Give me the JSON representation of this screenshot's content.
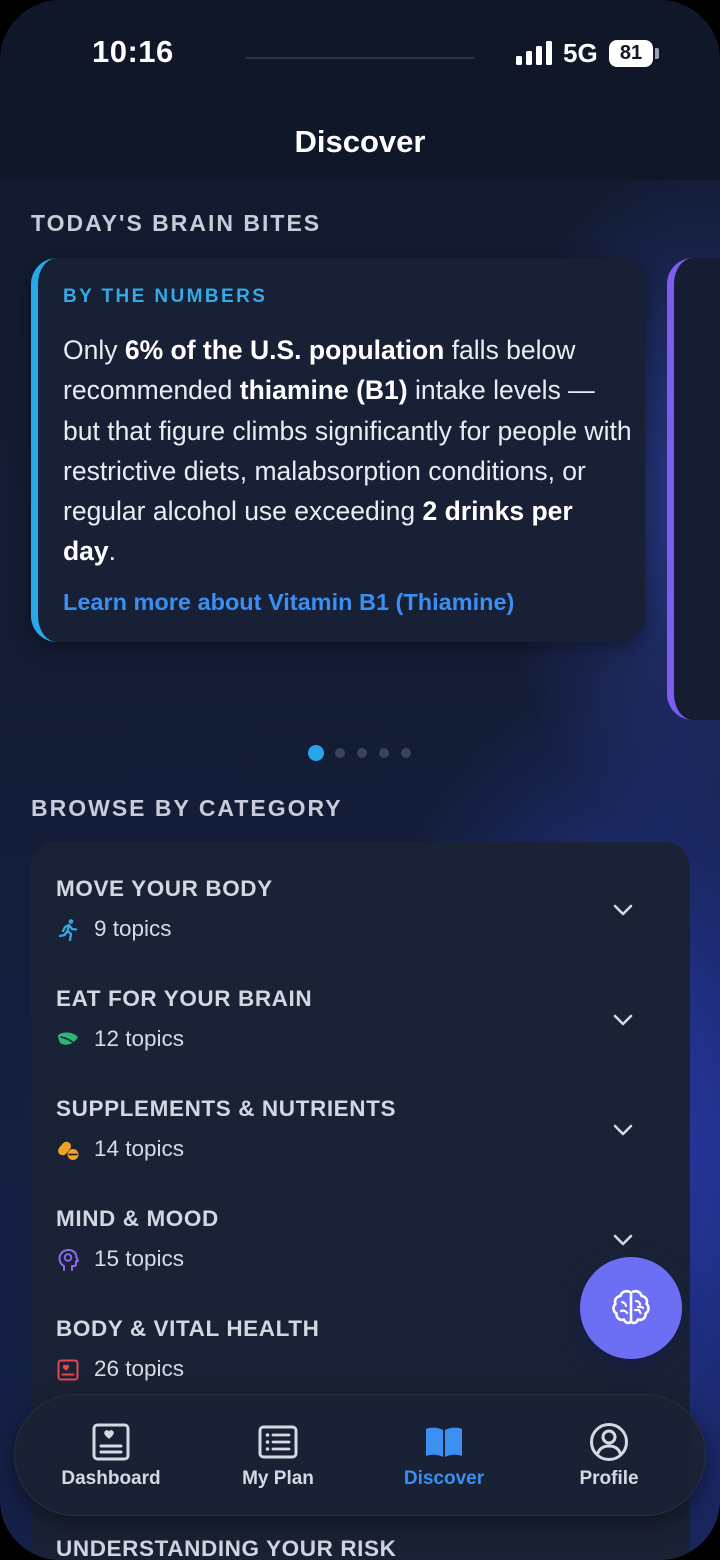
{
  "status_bar": {
    "time": "10:16",
    "network": "5G",
    "battery": "81"
  },
  "header": {
    "title": "Discover"
  },
  "brain_bites": {
    "section_label": "TODAY'S BRAIN BITES",
    "card": {
      "kicker": "BY THE NUMBERS",
      "body_parts": [
        "Only ",
        "6% of the U.S. population",
        " falls below recommended ",
        "thiamine (B1)",
        " intake levels — but that figure climbs significantly for people with restrictive diets, malabsorption conditions, or regular alcohol use exceeding ",
        "2 drinks per day",
        "."
      ],
      "link": "Learn more about Vitamin B1 (Thiamine)",
      "accent_color": "#2aa7e8"
    },
    "next_card_accent_color": "#7b5df0",
    "pagination": {
      "total": 5,
      "active": 1
    }
  },
  "categories": {
    "section_label": "BROWSE BY CATEGORY",
    "items": [
      {
        "name": "MOVE YOUR BODY",
        "count": "9 topics",
        "icon": "running-icon",
        "icon_color": "#3aa6e6"
      },
      {
        "name": "EAT FOR YOUR BRAIN",
        "count": "12 topics",
        "icon": "leaf-icon",
        "icon_color": "#2fb57a"
      },
      {
        "name": "SUPPLEMENTS & NUTRIENTS",
        "count": "14 topics",
        "icon": "pills-icon",
        "icon_color": "#f0a328"
      },
      {
        "name": "MIND & MOOD",
        "count": "15 topics",
        "icon": "head-brain-icon",
        "icon_color": "#8b6cf0"
      },
      {
        "name": "BODY & VITAL HEALTH",
        "count": "26 topics",
        "icon": "heart-card-icon",
        "icon_color": "#e8454e"
      },
      {
        "name": "UNDERSTANDING YOUR RISK",
        "count": "",
        "icon": "",
        "icon_color": ""
      }
    ]
  },
  "fab": {
    "icon": "brain-icon",
    "color": "#6c6ff4"
  },
  "tab_bar": {
    "active": "Discover",
    "items": [
      {
        "label": "Dashboard",
        "icon": "dashboard-icon"
      },
      {
        "label": "My Plan",
        "icon": "list-icon"
      },
      {
        "label": "Discover",
        "icon": "book-icon"
      },
      {
        "label": "Profile",
        "icon": "profile-icon"
      }
    ]
  }
}
